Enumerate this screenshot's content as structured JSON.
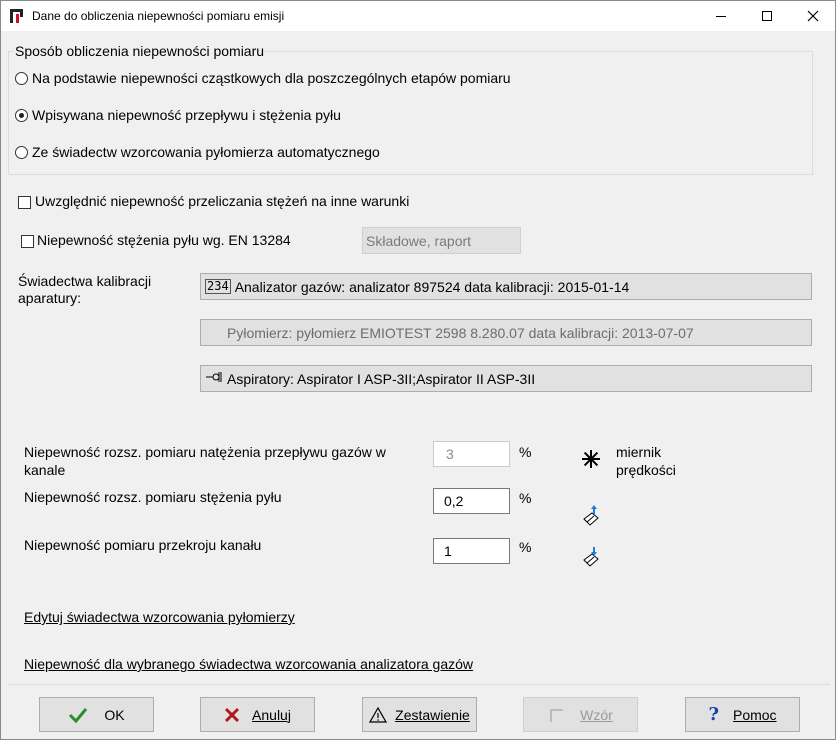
{
  "window": {
    "title": "Dane do obliczenia niepewności pomiaru emisji",
    "app_icon": "app-logo-icon",
    "controls": [
      "minimize-icon",
      "maximize-icon",
      "close-icon"
    ]
  },
  "method_group": {
    "title": "Sposób obliczenia niepewności pomiaru",
    "options": [
      {
        "label": "Na podstawie niepewności cząstkowych dla poszczególnych etapów pomiaru",
        "selected": false
      },
      {
        "label": "Wpisywana niepewność przepływu i stężenia  pyłu",
        "selected": true
      },
      {
        "label": "Ze świadectw wzorcowania pyłomierza automatycznego",
        "selected": false
      }
    ]
  },
  "checks": {
    "conversion_label": "Uwzględnić niepewność przeliczania  stężeń na inne warunki",
    "conversion_checked": false,
    "en13284_label": "Niepewność stężenia pyłu wg.  EN 13284",
    "en13284_checked": false,
    "components_button": "Składowe, raport"
  },
  "calibration": {
    "label": "Świadectwa kalibracji aparatury:",
    "gas_analyzer": "Analizator gazów: analizator 897524  data kalibracji: 2015-01-14",
    "gas_analyzer_icon": "digits-234-icon",
    "dust_meter": "Pyłomierz: pyłomierz EMIOTEST 2598 8.280.07 data kalibracji: 2013-07-07",
    "aspirators": "Aspiratory: Aspirator I ASP-3II;Aspirator II ASP-3II",
    "aspirators_icon": "pump-icon"
  },
  "uncertainties": {
    "flow_label": "Niepewność rozsz. pomiaru natężenia przepływu gazów w kanale",
    "flow_value": "3",
    "dust_label": "Niepewność rozsz. pomiaru stężenia pyłu",
    "dust_value": "0,2",
    "section_label": "Niepewność pomiaru przekroju kanału",
    "section_value": "1",
    "unit": "%",
    "speed_meter_label": "miernik prędkości",
    "speed_meter_icon": "fan-icon",
    "paste_icon": "eraser-up-icon",
    "paste_icon2": "eraser-down-icon"
  },
  "links": {
    "edit_certificates": "Edytuj świadectwa wzorcowania pyłomierzy",
    "analyzer_uncertainty": "Niepewność dla wybranego świadectwa wzorcowania analizatora gazów"
  },
  "buttons": {
    "ok": "OK",
    "cancel": "Anuluj",
    "summary": "Zestawienie",
    "pattern": "Wzór",
    "help": "Pomoc"
  },
  "colors": {
    "ok_check": "#2e8b2e",
    "cancel_x": "#b01818",
    "help_q": "#1c3fa8"
  }
}
